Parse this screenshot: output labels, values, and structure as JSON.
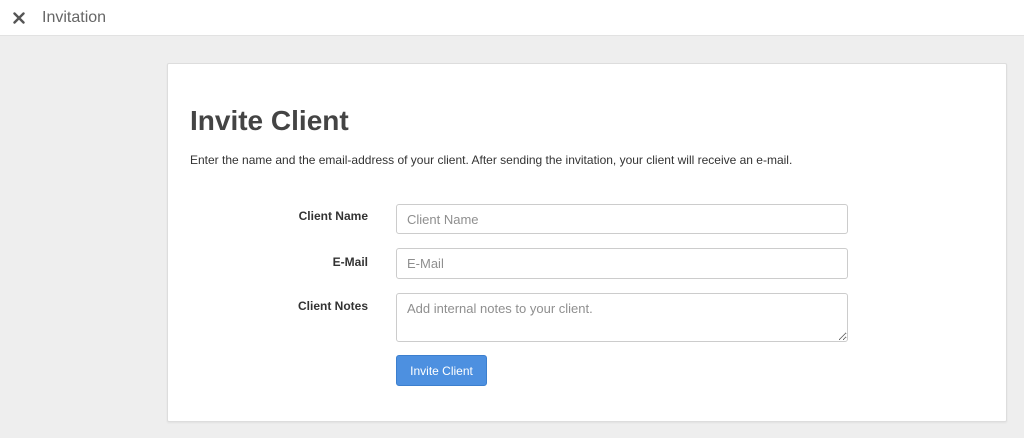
{
  "topbar": {
    "close_icon": "close-icon",
    "title": "Invitation"
  },
  "card": {
    "title": "Invite Client",
    "description": "Enter the name and the email-address of your client. After sending the invitation, your client will receive an e-mail."
  },
  "form": {
    "client_name": {
      "label": "Client Name",
      "value": "",
      "placeholder": "Client Name"
    },
    "email": {
      "label": "E-Mail",
      "value": "",
      "placeholder": "E-Mail"
    },
    "client_notes": {
      "label": "Client Notes",
      "value": "",
      "placeholder": "Add internal notes to your client."
    },
    "submit_label": "Invite Client"
  },
  "colors": {
    "primary_button": "#4d90e0",
    "page_background": "#eeeeee"
  }
}
